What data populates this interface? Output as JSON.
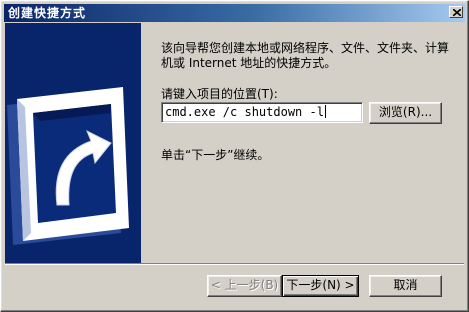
{
  "window": {
    "title": "创建快捷方式",
    "close_symbol": "×"
  },
  "main": {
    "description": "该向导帮您创建本地或网络程序、文件、文件夹、计算机或 Internet 地址的快捷方式。",
    "location_label": "请键入项目的位置(T):",
    "location_value": "cmd.exe /c shutdown -l",
    "browse_label": "浏览(R)...",
    "hint": "单击“下一步”继续。"
  },
  "footer": {
    "back_label": "< 上一步(B)",
    "next_label": "下一步(N) >",
    "cancel_label": "取消"
  },
  "icons": {
    "banner": "shortcut-arrow-icon",
    "close": "close-icon"
  },
  "colors": {
    "title_start": "#0a246a",
    "title_end": "#a6caf0",
    "banner_bg": "#08246b",
    "face": "#d4d0c8"
  }
}
